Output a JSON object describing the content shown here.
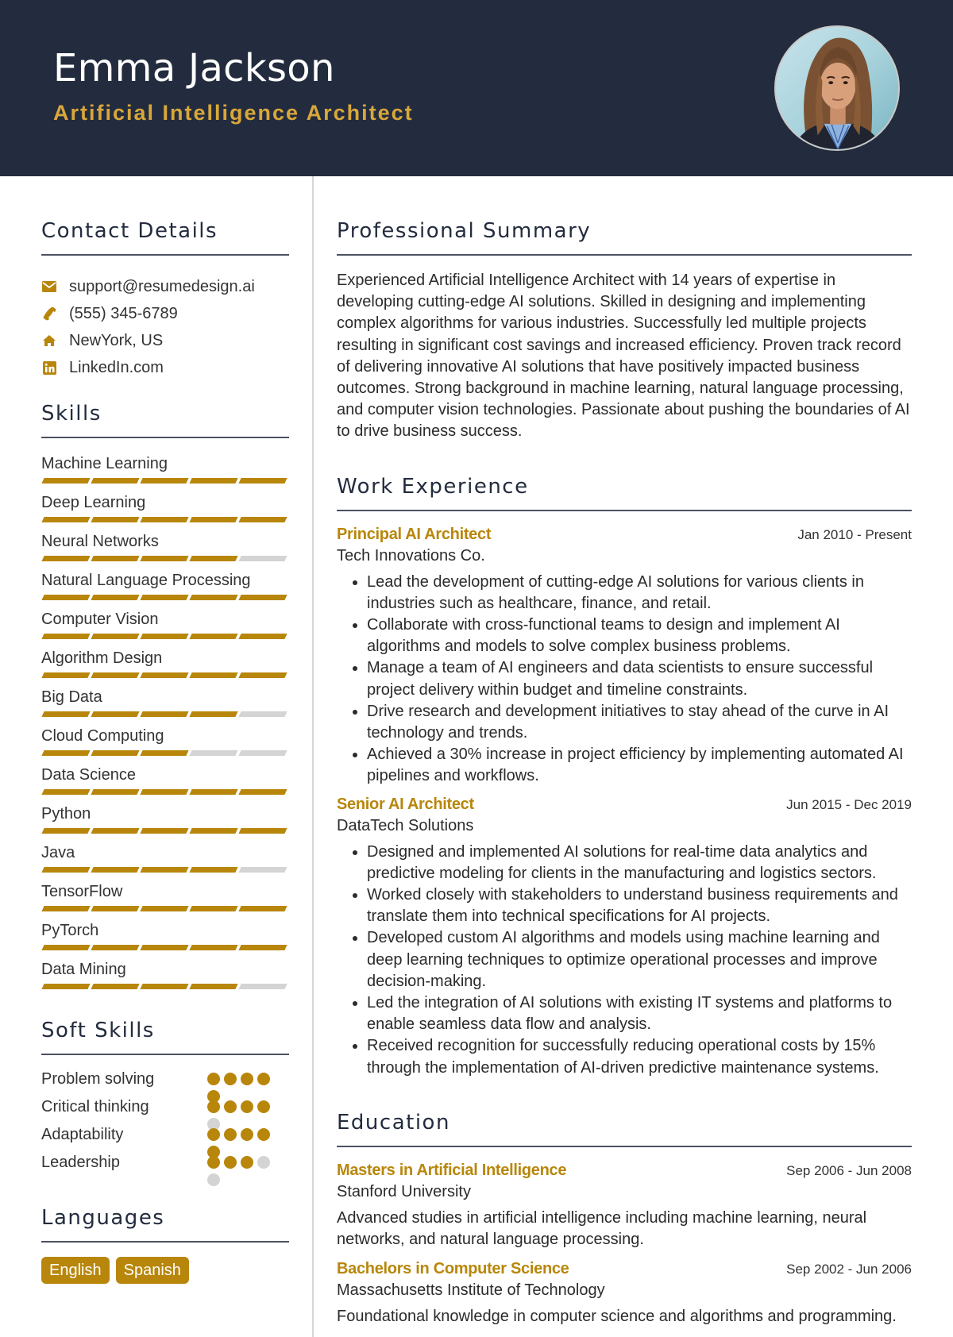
{
  "header": {
    "name": "Emma Jackson",
    "title": "Artificial Intelligence Architect",
    "photo_alt": "Profile photo of Emma Jackson"
  },
  "colors": {
    "header_bg": "#232c3e",
    "accent": "#b8860b",
    "title_gold": "#d9a73a",
    "inactive": "#d4d4d4"
  },
  "contact": {
    "heading": "Contact Details",
    "items": [
      {
        "icon": "envelope-icon",
        "text": "support@resumedesign.ai"
      },
      {
        "icon": "phone-icon",
        "text": "(555) 345-6789"
      },
      {
        "icon": "home-icon",
        "text": "NewYork, US"
      },
      {
        "icon": "linkedin-icon",
        "text": "LinkedIn.com"
      }
    ]
  },
  "skills": {
    "heading": "Skills",
    "max_level": 5,
    "items": [
      {
        "name": "Machine Learning",
        "level": 5
      },
      {
        "name": "Deep Learning",
        "level": 5
      },
      {
        "name": "Neural Networks",
        "level": 4
      },
      {
        "name": "Natural Language Processing",
        "level": 5
      },
      {
        "name": "Computer Vision",
        "level": 5
      },
      {
        "name": "Algorithm Design",
        "level": 5
      },
      {
        "name": "Big Data",
        "level": 4
      },
      {
        "name": "Cloud Computing",
        "level": 3
      },
      {
        "name": "Data Science",
        "level": 5
      },
      {
        "name": "Python",
        "level": 5
      },
      {
        "name": "Java",
        "level": 4
      },
      {
        "name": "TensorFlow",
        "level": 5
      },
      {
        "name": "PyTorch",
        "level": 5
      },
      {
        "name": "Data Mining",
        "level": 4
      }
    ]
  },
  "soft_skills": {
    "heading": "Soft Skills",
    "max_level": 5,
    "items": [
      {
        "name": "Problem solving",
        "level": 5
      },
      {
        "name": "Critical thinking",
        "level": 4
      },
      {
        "name": "Adaptability",
        "level": 5
      },
      {
        "name": "Leadership",
        "level": 3
      }
    ]
  },
  "languages": {
    "heading": "Languages",
    "items": [
      "English",
      "Spanish"
    ]
  },
  "summary": {
    "heading": "Professional Summary",
    "text": "Experienced Artificial Intelligence Architect with 14 years of expertise in developing cutting-edge AI solutions. Skilled in designing and implementing complex algorithms for various industries. Successfully led multiple projects resulting in significant cost savings and increased efficiency. Proven track record of delivering innovative AI solutions that have positively impacted business outcomes. Strong background in machine learning, natural language processing, and computer vision technologies. Passionate about pushing the boundaries of AI to drive business success."
  },
  "experience": {
    "heading": "Work Experience",
    "jobs": [
      {
        "title": "Principal AI Architect",
        "dates": "Jan 2010 - Present",
        "company": "Tech Innovations Co.",
        "bullets": [
          "Lead the development of cutting-edge AI solutions for various clients in industries such as healthcare, finance, and retail.",
          "Collaborate with cross-functional teams to design and implement AI algorithms and models to solve complex business problems.",
          "Manage a team of AI engineers and data scientists to ensure successful project delivery within budget and timeline constraints.",
          "Drive research and development initiatives to stay ahead of the curve in AI technology and trends.",
          "Achieved a 30% increase in project efficiency by implementing automated AI pipelines and workflows."
        ]
      },
      {
        "title": "Senior AI Architect",
        "dates": "Jun 2015 - Dec 2019",
        "company": "DataTech Solutions",
        "bullets": [
          "Designed and implemented AI solutions for real-time data analytics and predictive modeling for clients in the manufacturing and logistics sectors.",
          "Worked closely with stakeholders to understand business requirements and translate them into technical specifications for AI projects.",
          "Developed custom AI algorithms and models using machine learning and deep learning techniques to optimize operational processes and improve decision-making.",
          "Led the integration of AI solutions with existing IT systems and platforms to enable seamless data flow and analysis.",
          "Received recognition for successfully reducing operational costs by 15% through the implementation of AI-driven predictive maintenance systems."
        ]
      }
    ]
  },
  "education": {
    "heading": "Education",
    "items": [
      {
        "degree": "Masters in Artificial Intelligence",
        "dates": "Sep 2006 - Jun 2008",
        "school": "Stanford University",
        "description": "Advanced studies in artificial intelligence including machine learning, neural networks, and natural language processing."
      },
      {
        "degree": "Bachelors in Computer Science",
        "dates": "Sep 2002 - Jun 2006",
        "school": "Massachusetts Institute of Technology",
        "description": "Foundational knowledge in computer science and algorithms and programming."
      }
    ]
  }
}
